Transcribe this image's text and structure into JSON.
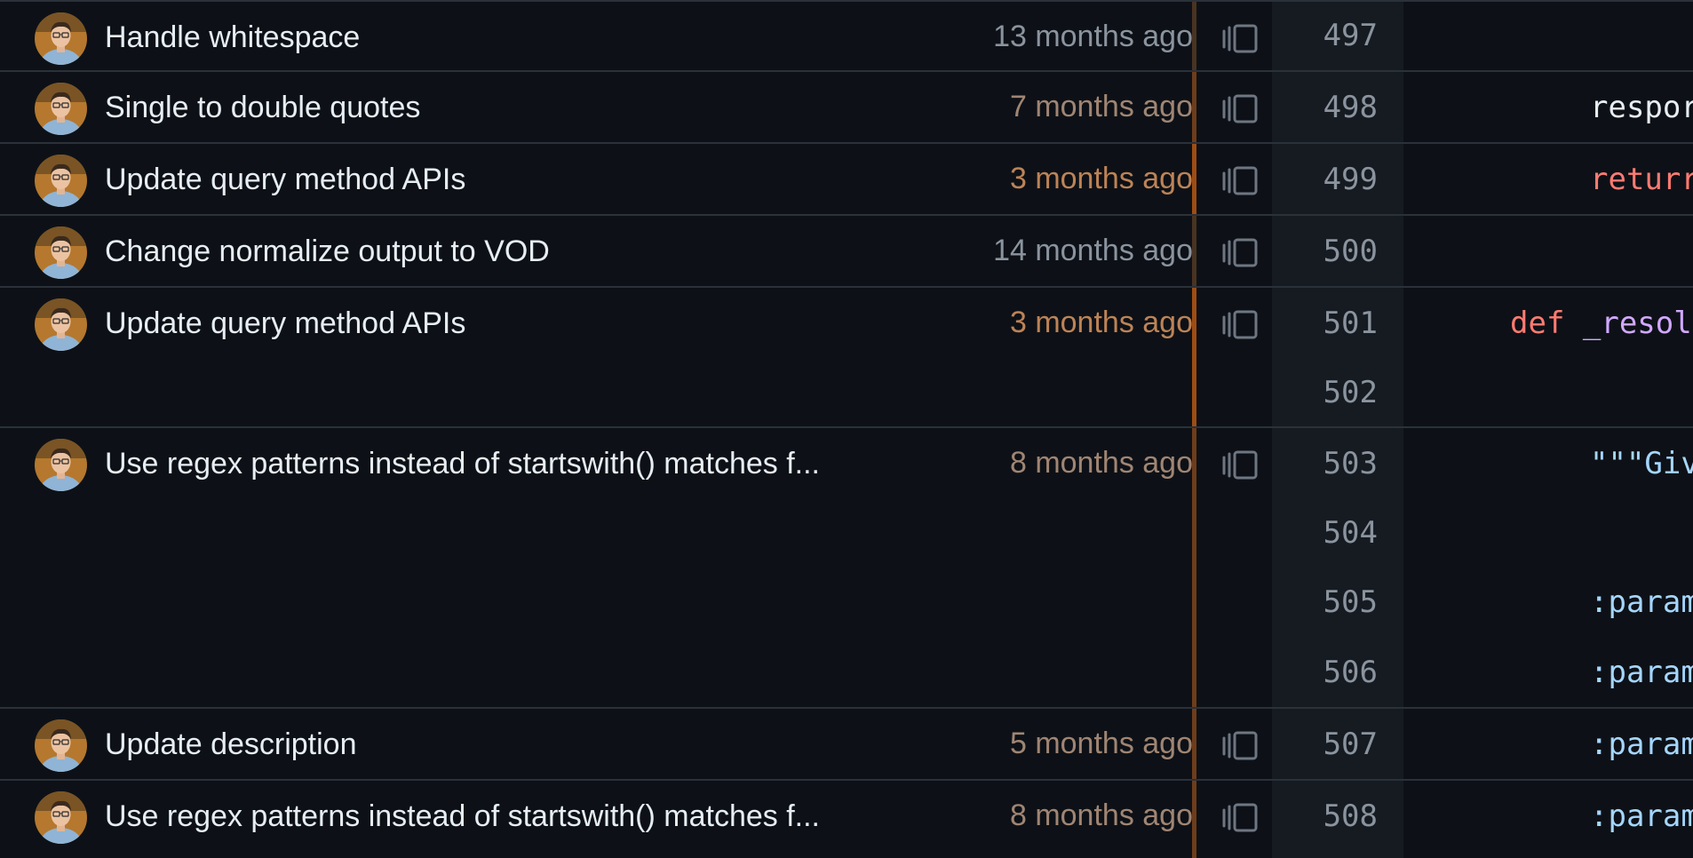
{
  "colors": {
    "age_recent": "#bd8356",
    "age_mid": "#a08573",
    "age_old": "#8b949e",
    "bar_recent": "#9e4d14",
    "bar_mid": "#6e3d1c",
    "bar_old": "#4a3322",
    "keyword": "#ff7b72",
    "function": "#d2a8ff",
    "string": "#a5d6ff",
    "plain": "#e6edf3"
  },
  "hunks": [
    {
      "message": "Handle whitespace",
      "age": "13 months ago",
      "recency": "old"
    },
    {
      "message": "Single to double quotes",
      "age": "7 months ago",
      "recency": "mid"
    },
    {
      "message": "Update query method APIs",
      "age": "3 months ago",
      "recency": "recent"
    },
    {
      "message": "Change normalize output to VOD",
      "age": "14 months ago",
      "recency": "old"
    },
    {
      "message": "Update query method APIs",
      "age": "3 months ago",
      "recency": "recent"
    },
    {
      "message": "Use regex patterns instead of startswith() matches f...",
      "age": "8 months ago",
      "recency": "mid"
    },
    {
      "message": "Update description",
      "age": "5 months ago",
      "recency": "mid"
    },
    {
      "message": "Use regex patterns instead of startswith() matches f...",
      "age": "8 months ago",
      "recency": "mid"
    }
  ],
  "lines": [
    {
      "number": "497",
      "code": "",
      "kind": "plain"
    },
    {
      "number": "498",
      "code": "respor",
      "kind": "plain"
    },
    {
      "number": "499",
      "code": "returr",
      "kind": "keyword"
    },
    {
      "number": "500",
      "code": "",
      "kind": "plain"
    },
    {
      "number": "501",
      "code": "def _resol",
      "kind": "def"
    },
    {
      "number": "502",
      "code": "",
      "kind": "plain"
    },
    {
      "number": "503",
      "code": "\"\"\"Giv",
      "kind": "string"
    },
    {
      "number": "504",
      "code": "",
      "kind": "plain"
    },
    {
      "number": "505",
      "code": ":param",
      "kind": "string"
    },
    {
      "number": "506",
      "code": ":param",
      "kind": "string"
    },
    {
      "number": "507",
      "code": ":param",
      "kind": "string"
    },
    {
      "number": "508",
      "code": ":param",
      "kind": "string"
    }
  ]
}
